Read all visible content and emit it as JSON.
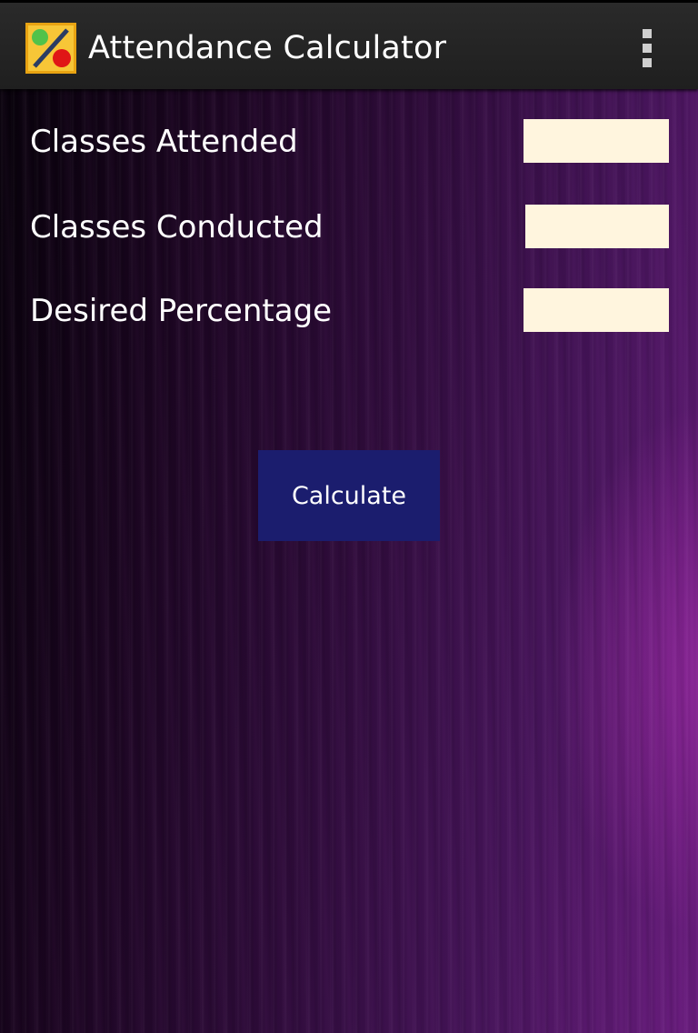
{
  "app_bar": {
    "title": "Attendance Calculator",
    "icon": "percent-app-icon",
    "menu_icon": "overflow-menu-icon",
    "background_color": "#222222"
  },
  "form": {
    "fields": [
      {
        "label": "Classes Attended",
        "value": ""
      },
      {
        "label": "Classes Conducted",
        "value": ""
      },
      {
        "label": "Desired Percentage",
        "value": ""
      }
    ],
    "field_background": "#fff5de"
  },
  "calculate_button": {
    "label": "Calculate",
    "color": "#1b1d6e"
  },
  "theme": {
    "background": "purple-streaked-gradient",
    "accent": "#6a1c7f"
  }
}
